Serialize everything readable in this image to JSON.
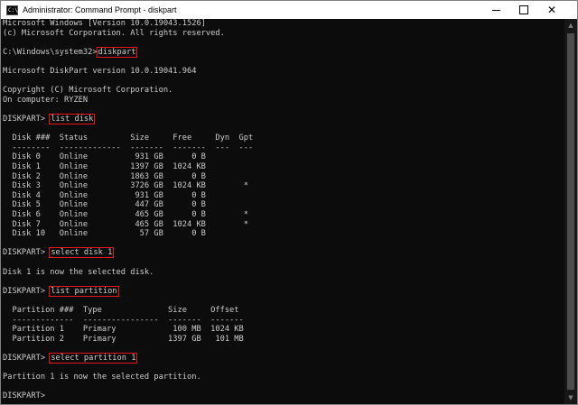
{
  "window": {
    "app_icon_text": "C:\\",
    "title": "Administrator: Command Prompt - diskpart"
  },
  "console": {
    "lines": [
      {
        "pre": "Microsoft Windows [Version 10.0.19043.1526]",
        "cmd": ""
      },
      {
        "pre": "(c) Microsoft Corporation. All rights reserved.",
        "cmd": ""
      },
      {
        "pre": "",
        "cmd": ""
      },
      {
        "pre": "C:\\Windows\\system32>",
        "cmd": "diskpart"
      },
      {
        "pre": "",
        "cmd": ""
      },
      {
        "pre": "Microsoft DiskPart version 10.0.19041.964",
        "cmd": ""
      },
      {
        "pre": "",
        "cmd": ""
      },
      {
        "pre": "Copyright (C) Microsoft Corporation.",
        "cmd": ""
      },
      {
        "pre": "On computer: RYZEN",
        "cmd": ""
      },
      {
        "pre": "",
        "cmd": ""
      },
      {
        "pre": "DISKPART> ",
        "cmd": "list disk"
      },
      {
        "pre": "",
        "cmd": ""
      },
      {
        "pre": "  Disk ###  Status         Size     Free     Dyn  Gpt",
        "cmd": ""
      },
      {
        "pre": "  --------  -------------  -------  -------  ---  ---",
        "cmd": ""
      },
      {
        "pre": "  Disk 0    Online          931 GB      0 B",
        "cmd": ""
      },
      {
        "pre": "  Disk 1    Online         1397 GB  1024 KB",
        "cmd": ""
      },
      {
        "pre": "  Disk 2    Online         1863 GB      0 B",
        "cmd": ""
      },
      {
        "pre": "  Disk 3    Online         3726 GB  1024 KB        *",
        "cmd": ""
      },
      {
        "pre": "  Disk 4    Online          931 GB      0 B",
        "cmd": ""
      },
      {
        "pre": "  Disk 5    Online          447 GB      0 B",
        "cmd": ""
      },
      {
        "pre": "  Disk 6    Online          465 GB      0 B        *",
        "cmd": ""
      },
      {
        "pre": "  Disk 7    Online          465 GB  1024 KB        *",
        "cmd": ""
      },
      {
        "pre": "  Disk 10   Online           57 GB      0 B",
        "cmd": ""
      },
      {
        "pre": "",
        "cmd": ""
      },
      {
        "pre": "DISKPART> ",
        "cmd": "select disk 1"
      },
      {
        "pre": "",
        "cmd": ""
      },
      {
        "pre": "Disk 1 is now the selected disk.",
        "cmd": ""
      },
      {
        "pre": "",
        "cmd": ""
      },
      {
        "pre": "DISKPART> ",
        "cmd": "list partition"
      },
      {
        "pre": "",
        "cmd": ""
      },
      {
        "pre": "  Partition ###  Type              Size     Offset",
        "cmd": ""
      },
      {
        "pre": "  -------------  ----------------  -------  -------",
        "cmd": ""
      },
      {
        "pre": "  Partition 1    Primary            100 MB  1024 KB",
        "cmd": ""
      },
      {
        "pre": "  Partition 2    Primary           1397 GB   101 MB",
        "cmd": ""
      },
      {
        "pre": "",
        "cmd": ""
      },
      {
        "pre": "DISKPART> ",
        "cmd": "select partition 1"
      },
      {
        "pre": "",
        "cmd": ""
      },
      {
        "pre": "Partition 1 is now the selected partition.",
        "cmd": ""
      },
      {
        "pre": "",
        "cmd": ""
      },
      {
        "pre": "DISKPART>",
        "cmd": ""
      }
    ]
  },
  "colors": {
    "background": "#0c0c0c",
    "text": "#cccccc",
    "highlight_box": "#e8131b",
    "titlebar": "#ffffff"
  },
  "icons": {
    "minimize": "minimize-icon",
    "maximize": "maximize-icon",
    "close": "close-icon",
    "scroll_up": "scroll-up-arrow-icon",
    "scroll_down": "scroll-down-arrow-icon"
  }
}
